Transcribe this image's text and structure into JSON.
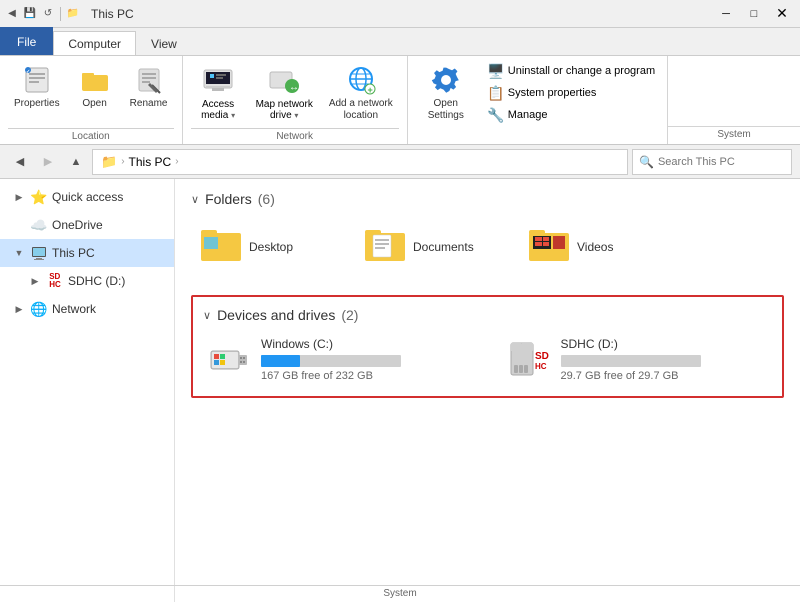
{
  "titleBar": {
    "title": "This PC",
    "icons": [
      "back-icon",
      "save-icon",
      "undo-icon"
    ]
  },
  "ribbonTabs": [
    {
      "id": "file",
      "label": "File",
      "active": false,
      "isFile": true
    },
    {
      "id": "computer",
      "label": "Computer",
      "active": true,
      "isFile": false
    },
    {
      "id": "view",
      "label": "View",
      "active": false,
      "isFile": false
    }
  ],
  "ribbon": {
    "groups": [
      {
        "id": "location",
        "label": "Location",
        "buttons": [
          {
            "id": "properties",
            "label": "Properties",
            "icon": "🔲"
          },
          {
            "id": "open",
            "label": "Open",
            "icon": "📂"
          },
          {
            "id": "rename",
            "label": "Rename",
            "icon": "✏️"
          }
        ]
      },
      {
        "id": "network",
        "label": "Network",
        "buttons": [
          {
            "id": "access-media",
            "label": "Access\nmedia",
            "icon": "🖥️",
            "dropdown": true
          },
          {
            "id": "map-network-drive",
            "label": "Map network\ndrive",
            "icon": "🗺️",
            "dropdown": true
          },
          {
            "id": "add-network-location",
            "label": "Add a network\nlocation",
            "icon": "🌐"
          }
        ]
      },
      {
        "id": "system",
        "label": "System",
        "buttons": [
          {
            "id": "open-settings",
            "label": "Open\nSettings",
            "icon": "⚙️"
          }
        ],
        "smallButtons": [
          {
            "id": "uninstall",
            "label": "Uninstall or change a program",
            "icon": "🖥️"
          },
          {
            "id": "system-properties",
            "label": "System properties",
            "icon": "📋"
          },
          {
            "id": "manage",
            "label": "Manage",
            "icon": "🔧"
          }
        ]
      }
    ]
  },
  "addressBar": {
    "backDisabled": false,
    "forwardDisabled": true,
    "upLabel": "Up",
    "path": [
      "This PC"
    ],
    "searchPlaceholder": "Search This PC"
  },
  "sidebar": {
    "items": [
      {
        "id": "quick-access",
        "label": "Quick access",
        "icon": "⭐",
        "expandable": true,
        "color": "#2d5fa6"
      },
      {
        "id": "onedrive",
        "label": "OneDrive",
        "icon": "☁️",
        "expandable": false,
        "color": "#0078d4"
      },
      {
        "id": "this-pc",
        "label": "This PC",
        "icon": "💻",
        "expandable": true,
        "active": true,
        "color": "#555"
      },
      {
        "id": "sdhc",
        "label": "SDHC (D:)",
        "icon": "SD",
        "expandable": true,
        "isSd": true
      },
      {
        "id": "network",
        "label": "Network",
        "icon": "🌐",
        "expandable": true,
        "color": "#0078d4"
      }
    ]
  },
  "content": {
    "foldersSection": {
      "label": "Folders",
      "count": "(6)",
      "folders": [
        {
          "id": "desktop",
          "name": "Desktop",
          "icon": "folder-blue"
        },
        {
          "id": "documents",
          "name": "Documents",
          "icon": "folder-doc"
        },
        {
          "id": "videos",
          "name": "Videos",
          "icon": "folder-video"
        }
      ]
    },
    "drivesSection": {
      "label": "Devices and drives",
      "count": "(2)",
      "highlighted": true,
      "drives": [
        {
          "id": "windows-c",
          "name": "Windows (C:)",
          "icon": "windows-drive",
          "barFillPercent": 28,
          "freeSpace": "167 GB free of 232 GB"
        },
        {
          "id": "sdhc-d",
          "name": "SDHC (D:)",
          "icon": "sd-drive",
          "barFillPercent": 0,
          "freeSpace": "29.7 GB free of 29.7 GB"
        }
      ]
    }
  }
}
